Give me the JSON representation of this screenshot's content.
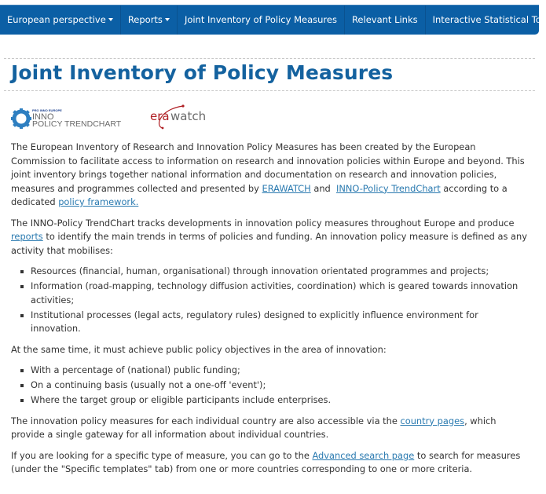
{
  "nav": {
    "items": [
      {
        "label": "European perspective",
        "dropdown": true
      },
      {
        "label": "Reports",
        "dropdown": true
      },
      {
        "label": "Joint Inventory of Policy Measures",
        "dropdown": false
      },
      {
        "label": "Relevant Links",
        "dropdown": false
      },
      {
        "label": "Interactive Statistical Tool",
        "dropdown": false
      }
    ],
    "background_color": "#0b5fa5"
  },
  "page": {
    "title": "Joint Inventory of Policy Measures",
    "title_color": "#14629f",
    "link_color": "#2a7ab0"
  },
  "logos": {
    "inno": {
      "small_text": "PRO INNO EUROPE",
      "line1": "INNO",
      "line2": "POLICY TRENDCHART"
    },
    "erawatch": {
      "text_red": "era",
      "text_grey": "watch"
    }
  },
  "intro": {
    "text1": "The European Inventory of Research and Innovation Policy Measures has been created by the European Commission to facilitate access to information on research and innovation policies within Europe and beyond. This joint inventory brings together national information and documentation on research and innovation policies, measures and programmes collected and presented by ",
    "link_erawatch": "ERAWATCH",
    "text2": " and  ",
    "link_trendchart": "INNO-Policy TrendChart",
    "text3": " according to a dedicated ",
    "link_framework": "policy framework."
  },
  "trendchart": {
    "text1": "The INNO-Policy TrendChart tracks developments in innovation policy measures throughout Europe and produce ",
    "link_reports": "reports",
    "text2": " to identify the main trends in terms of policies and funding. An innovation policy measure is defined as any activity that mobilises:"
  },
  "mobilises_list": [
    "Resources (financial, human, organisational) through innovation orientated programmes and projects;",
    "Information (road-mapping, technology diffusion activities, coordination) which is geared towards innovation activities;",
    "Institutional processes (legal acts, regulatory rules) designed to explicitly influence environment for innovation."
  ],
  "objectives": {
    "text": "At the same time, it must achieve public policy objectives in the area of innovation:"
  },
  "objectives_list": [
    "With a percentage of (national) public funding;",
    "On a continuing basis (usually not a one-off 'event');",
    "Where the target group or eligible participants include enterprises."
  ],
  "country": {
    "text1": "The innovation policy measures for each individual country are also accessible via the ",
    "link": "country pages",
    "text2": ", which provide a single gateway for all information about individual countries."
  },
  "search": {
    "text1": "If you are looking for a specific type of measure, you can go to the ",
    "link": "Advanced search page",
    "text2": " to search for measures (under the \"Specific templates\" tab) from one or more countries corresponding to one or more criteria."
  }
}
